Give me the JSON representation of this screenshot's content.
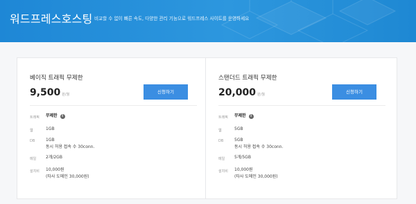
{
  "banner": {
    "title": "워드프레스호스팅",
    "subtitle": "비교할 수 없이 빠른 속도, 다양한 관리 기능으로 워드프레스 사이트를 운영하세요"
  },
  "plans": [
    {
      "name": "베이직 트래픽 무제한",
      "price": "9,500",
      "price_unit": "원/월",
      "button_label": "신청하기",
      "specs": {
        "traffic_label": "트래픽",
        "traffic_value": "무제한",
        "web_label": "웹",
        "web_value": "1GB",
        "db_label": "DB",
        "db_value": "1GB",
        "db_note": "동시 허용 접속 수 30conn.",
        "mail_label": "메일",
        "mail_value": "2개/2GB",
        "setup_label": "설치비",
        "setup_value": "10,000원",
        "setup_note": "(타사 도메인 30,000원)"
      }
    },
    {
      "name": "스탠더드 트래픽 무제한",
      "price": "20,000",
      "price_unit": "원/월",
      "button_label": "신청하기",
      "specs": {
        "traffic_label": "트래픽",
        "traffic_value": "무제한",
        "web_label": "웹",
        "web_value": "5GB",
        "db_label": "DB",
        "db_value": "5GB",
        "db_note": "동시 허용 접속 수 30conn.",
        "mail_label": "메일",
        "mail_value": "5개/5GB",
        "setup_label": "설치비",
        "setup_value": "10,000원",
        "setup_note": "(타사 도메인 30,000원)"
      }
    }
  ],
  "icons": {
    "info": "info-icon"
  },
  "colors": {
    "banner": "#2d97de",
    "button": "#3b8ee2"
  }
}
